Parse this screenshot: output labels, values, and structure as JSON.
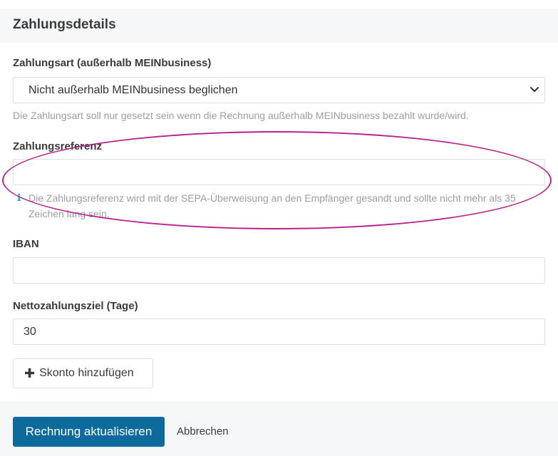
{
  "panel": {
    "title": "Zahlungsdetails"
  },
  "payment_method": {
    "label": "Zahlungsart (außerhalb MEINbusiness)",
    "selected": "Nicht außerhalb MEINbusiness beglichen",
    "help": "Die Zahlungsart soll nur gesetzt sein wenn die Rechnung außerhalb MEINbusiness bezahlt wurde/wird."
  },
  "payment_reference": {
    "label": "Zahlungsreferenz",
    "value": "",
    "info_glyph": "i",
    "help": "Die Zahlungsreferenz wird mit der SEPA-Überweisung an den Empfänger gesandt und sollte nicht mehr als 35 Zeichen lang sein."
  },
  "iban": {
    "label": "IBAN",
    "value": ""
  },
  "net_terms": {
    "label": "Nettozahlungsziel (Tage)",
    "value": "30"
  },
  "add_discount": {
    "icon": "plus-icon",
    "label": "Skonto hinzufügen"
  },
  "footer": {
    "submit_label": "Rechnung aktualisieren",
    "cancel_label": "Abbrechen"
  },
  "colors": {
    "primary": "#0c6a9c",
    "highlight": "#b8228c",
    "info": "#19a5a8"
  }
}
